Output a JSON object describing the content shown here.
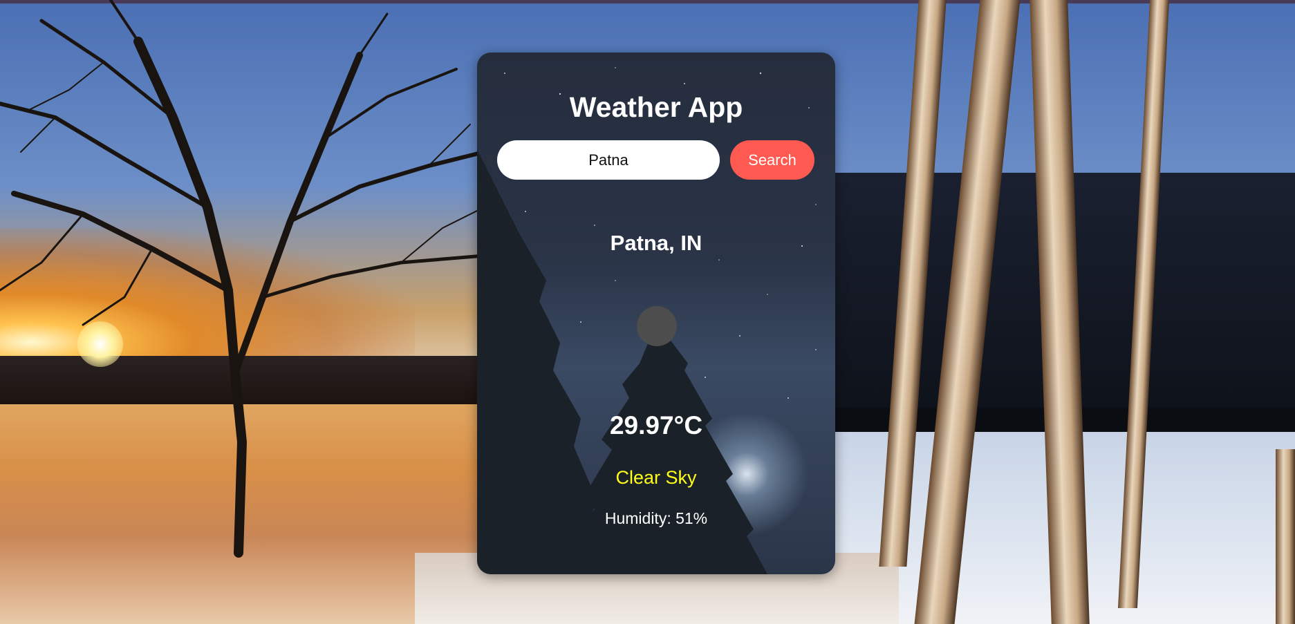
{
  "app": {
    "title": "Weather App"
  },
  "search": {
    "value": "Patna",
    "placeholder": "",
    "button_label": "Search"
  },
  "weather": {
    "location": "Patna, IN",
    "temperature": "29.97°C",
    "description": "Clear Sky",
    "humidity": "Humidity: 51%",
    "icon": "weather-icon"
  },
  "colors": {
    "search_button": "#ff5a52",
    "description_text": "#ffff1a",
    "icon_placeholder": "#4d4d4d"
  }
}
